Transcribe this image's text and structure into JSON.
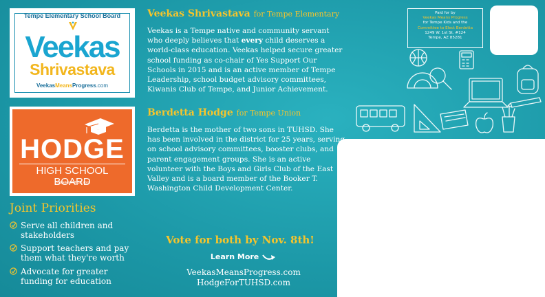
{
  "veekas_logo": {
    "board": "Tempe Elementary School Board",
    "first_name": "Veekas",
    "last_name": "Shrivastava",
    "url_part1": "Veekas",
    "url_part2": "Means",
    "url_part3": "Progress",
    "url_part4": ".com"
  },
  "hodge_logo": {
    "name": "HODGE",
    "subtitle": "HIGH SCHOOL BOARD",
    "url": "HodgeForTUHSD.com"
  },
  "joint": {
    "title": "Joint Priorities",
    "items": [
      "Serve all children and stakeholders",
      "Support teachers and pay them what they're worth",
      "Advocate for greater funding for education"
    ]
  },
  "veekas": {
    "name": "Veekas Shrivastava",
    "for": "for Tempe Elementary",
    "bio_a": "Veekas is a Tempe native and community servant who deeply believes that ",
    "bio_every": "every",
    "bio_b": " child deserves a world-class education. Veekas helped secure greater school funding as co-chair of Yes Support Our Schools in 2015 and is an active member of Tempe Leadership, school budget advisory committees, Kiwanis Club of Tempe, and Junior Achievement."
  },
  "hodge": {
    "name": "Berdetta Hodge",
    "for": "for Tempe Union",
    "bio": "Berdetta is the mother of two sons in TUHSD. She has been involved in the district for 25 years, serving on school advisory committees, booster clubs, and parent engagement groups. She is an active volunteer with the Boys and Girls Club of the East Valley and is a board member of the Booker T. Washington Child Development Center."
  },
  "vote": "Vote for both by Nov. 8th!",
  "learn_more": "Learn More",
  "sites": [
    "VeekasMeansProgress.com",
    "HodgeForTUHSD.com"
  ],
  "paid_for": {
    "line1": "Paid for by",
    "line2": "Veekas Means Progress",
    "line3": "for Tempe Kids and the",
    "line4": "Committee to Elect Berdetta",
    "line5": "1249 W. 1st St. #124",
    "line6": "Tempe, AZ 85281"
  },
  "colors": {
    "background": "#1f9fae",
    "accent_yellow": "#f6c52c",
    "veekas_blue": "#1aa5d0",
    "hodge_orange": "#ee6a2b"
  }
}
